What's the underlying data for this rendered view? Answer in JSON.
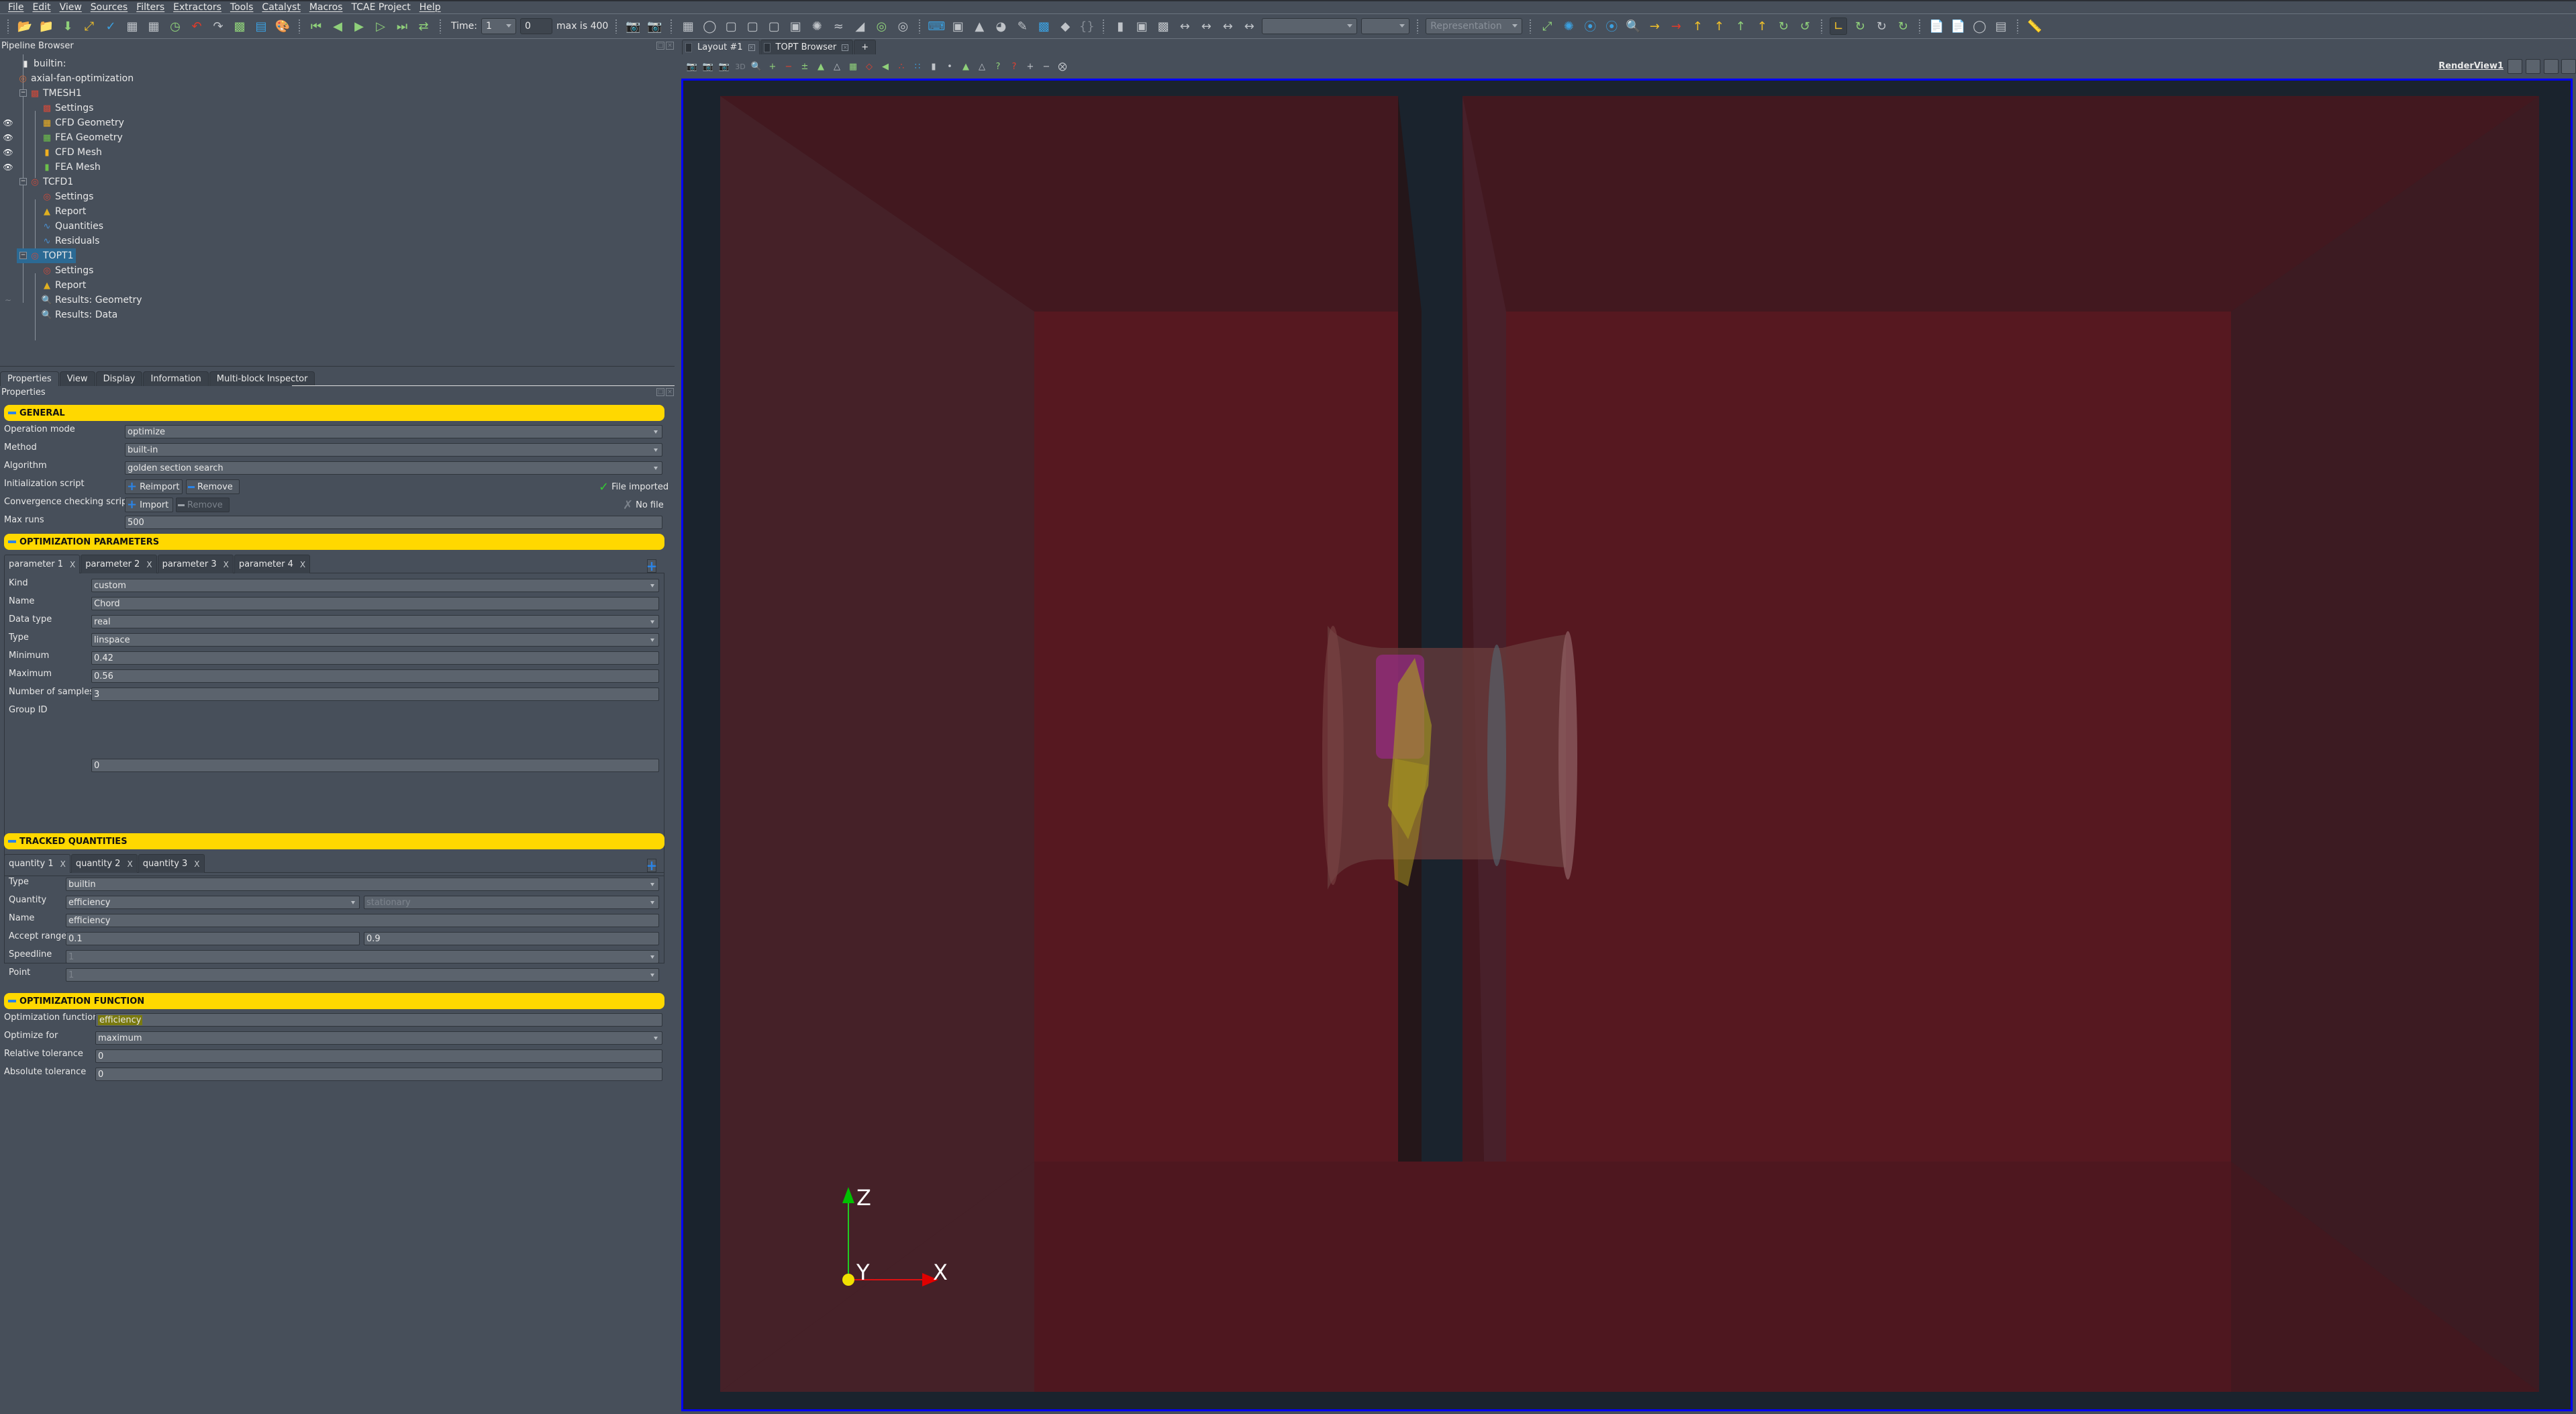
{
  "menu": [
    "File",
    "Edit",
    "View",
    "Sources",
    "Filters",
    "Extractors",
    "Tools",
    "Catalyst",
    "Macros",
    "TCAE Project",
    "Help"
  ],
  "toolbar": {
    "time_label": "Time:",
    "time_value": "1",
    "time_index": "0",
    "max_label": "max is 400",
    "representation_placeholder": "Representation",
    "icons_group1": [
      "open-folder-icon",
      "save-state-icon",
      "download-icon",
      "connect-icon",
      "pencil-icon"
    ],
    "icons_group2": [
      "server-connect-icon",
      "server-disconnect-icon",
      "reset-session-icon"
    ],
    "icons_group3": [
      "undo-icon",
      "redo-icon"
    ],
    "icons_group4": [
      "find-data-icon",
      "color-legend-icon",
      "palette-icon"
    ],
    "icons_vcr": [
      "first-frame-icon",
      "previous-frame-icon",
      "play-icon",
      "next-frame-icon",
      "last-frame-icon",
      "loop-icon"
    ]
  },
  "pipeline_browser": {
    "title": "Pipeline Browser",
    "items": [
      {
        "label": "builtin:",
        "level": 0,
        "icon": "server-icon"
      },
      {
        "label": "axial-fan-optimization",
        "level": 0,
        "icon": "project-icon"
      },
      {
        "label": "TMESH1",
        "level": 1,
        "icon": "tmesh-icon",
        "expanded": true
      },
      {
        "label": "Settings",
        "level": 2,
        "icon": "tmesh-settings-icon"
      },
      {
        "label": "CFD Geometry",
        "level": 2,
        "icon": "cfd-geometry-icon",
        "visible": true
      },
      {
        "label": "FEA Geometry",
        "level": 2,
        "icon": "fea-geometry-icon",
        "visible": true
      },
      {
        "label": "CFD Mesh",
        "level": 2,
        "icon": "cfd-mesh-icon",
        "visible": true
      },
      {
        "label": "FEA Mesh",
        "level": 2,
        "icon": "fea-mesh-icon",
        "visible": true
      },
      {
        "label": "TCFD1",
        "level": 1,
        "icon": "tcfd-icon",
        "expanded": true
      },
      {
        "label": "Settings",
        "level": 2,
        "icon": "tcfd-settings-icon"
      },
      {
        "label": "Report",
        "level": 2,
        "icon": "report-icon"
      },
      {
        "label": "Quantities",
        "level": 2,
        "icon": "quantities-chart-icon"
      },
      {
        "label": "Residuals",
        "level": 2,
        "icon": "residuals-chart-icon"
      },
      {
        "label": "TOPT1",
        "level": 1,
        "icon": "topt-icon",
        "expanded": true,
        "selected": true
      },
      {
        "label": "Settings",
        "level": 2,
        "icon": "topt-settings-icon"
      },
      {
        "label": "Report",
        "level": 2,
        "icon": "report-icon"
      },
      {
        "label": "Results: Geometry",
        "level": 2,
        "icon": "results-icon",
        "visible": false
      },
      {
        "label": "Results: Data",
        "level": 2,
        "icon": "results-icon"
      }
    ]
  },
  "panel_tabs": [
    "Properties",
    "View",
    "Display",
    "Information",
    "Multi-block Inspector"
  ],
  "properties_title": "Properties",
  "general": {
    "header": "GENERAL",
    "operation_mode_label": "Operation mode",
    "operation_mode": "optimize",
    "method_label": "Method",
    "method": "built-in",
    "algorithm_label": "Algorithm",
    "algorithm": "golden section search",
    "init_script_label": "Initialization script",
    "init_reimport": "Reimport",
    "init_remove": "Remove",
    "init_status": "File imported",
    "conv_script_label": "Convergence checking script",
    "conv_import": "Import",
    "conv_remove": "Remove",
    "conv_status": "No file",
    "max_runs_label": "Max runs",
    "max_runs": "500"
  },
  "opt_params": {
    "header": "OPTIMIZATION PARAMETERS",
    "tabs": [
      "parameter 1",
      "parameter 2",
      "parameter 3",
      "parameter 4"
    ],
    "kind_label": "Kind",
    "kind": "custom",
    "name_label": "Name",
    "name": "Chord",
    "data_type_label": "Data type",
    "data_type": "real",
    "type_label": "Type",
    "type": "linspace",
    "minimum_label": "Minimum",
    "minimum": "0.42",
    "maximum_label": "Maximum",
    "maximum": "0.56",
    "samples_label": "Number of samples",
    "samples": "3",
    "group_id_label": "Group ID",
    "group_id": "0"
  },
  "tracked": {
    "header": "TRACKED QUANTITIES",
    "tabs": [
      "quantity 1",
      "quantity 2",
      "quantity 3"
    ],
    "type_label": "Type",
    "type": "builtin",
    "quantity_label": "Quantity",
    "quantity": "efficiency",
    "quantity_mode": "stationary",
    "name_label": "Name",
    "name": "efficiency",
    "accept_label": "Accept range",
    "accept_min": "0.1",
    "accept_max": "0.9",
    "speedline_label": "Speedline",
    "speedline": "1",
    "point_label": "Point",
    "point": "1"
  },
  "opt_function": {
    "header": "OPTIMIZATION FUNCTION",
    "function_label": "Optimization function",
    "function": "efficiency",
    "optimize_for_label": "Optimize for",
    "optimize_for": "maximum",
    "rel_tol_label": "Relative tolerance",
    "rel_tol": "0",
    "abs_tol_label": "Absolute tolerance",
    "abs_tol": "0"
  },
  "layout_tabs": [
    "Layout #1",
    "TOPT Browser"
  ],
  "layout_add": "+",
  "render_view_label": "RenderView1",
  "axes": {
    "x": "X",
    "y": "Y",
    "z": "Z"
  },
  "colors": {
    "section_header": "#ffd800",
    "accent_blue": "#2a84e8",
    "selection": "#2c6a94",
    "viewport_border": "#0000ff",
    "viewport_bg": "#1a232d"
  }
}
